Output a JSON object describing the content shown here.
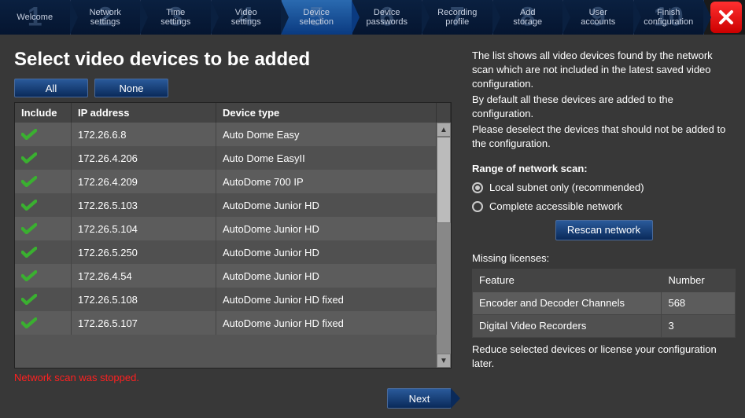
{
  "steps": [
    {
      "num": "1",
      "label": "Welcome"
    },
    {
      "num": "2",
      "label": "Network\nsettings"
    },
    {
      "num": "3",
      "label": "Time\nsettings"
    },
    {
      "num": "4",
      "label": "Video\nsettings"
    },
    {
      "num": "5",
      "label": "Device\nselection"
    },
    {
      "num": "6",
      "label": "Device\npasswords"
    },
    {
      "num": "7",
      "label": "Recording\nprofile"
    },
    {
      "num": "8",
      "label": "Add\nstorage"
    },
    {
      "num": "9",
      "label": "User\naccounts"
    },
    {
      "num": "10",
      "label": "Finish\nconfiguration"
    }
  ],
  "active_step": 4,
  "title": "Select video devices to be added",
  "buttons": {
    "all": "All",
    "none": "None",
    "next": "Next",
    "rescan": "Rescan network"
  },
  "table": {
    "headers": {
      "include": "Include",
      "ip": "IP address",
      "type": "Device type"
    },
    "rows": [
      {
        "ip": "172.26.6.8",
        "type": "Auto Dome Easy"
      },
      {
        "ip": "172.26.4.206",
        "type": "Auto Dome EasyII"
      },
      {
        "ip": "172.26.4.209",
        "type": "AutoDome 700 IP"
      },
      {
        "ip": "172.26.5.103",
        "type": "AutoDome Junior HD"
      },
      {
        "ip": "172.26.5.104",
        "type": "AutoDome Junior HD"
      },
      {
        "ip": "172.26.5.250",
        "type": "AutoDome Junior HD"
      },
      {
        "ip": "172.26.4.54",
        "type": "AutoDome Junior HD"
      },
      {
        "ip": "172.26.5.108",
        "type": "AutoDome Junior HD fixed"
      },
      {
        "ip": "172.26.5.107",
        "type": "AutoDome Junior HD fixed"
      }
    ]
  },
  "status": "Network scan was stopped.",
  "help": {
    "p1": "The list shows all video devices found by the network scan which are not included in the latest saved video configuration.",
    "p2": "By default all these devices are added to the configuration.",
    "p3": "Please deselect the devices that should not be added to the configuration."
  },
  "range": {
    "title": "Range of network scan:",
    "opt1": "Local subnet only (recommended)",
    "opt2": "Complete accessible network",
    "selected": 0
  },
  "licenses": {
    "title": "Missing licenses:",
    "headers": {
      "feature": "Feature",
      "number": "Number"
    },
    "rows": [
      {
        "feature": "Encoder and Decoder Channels",
        "number": "568"
      },
      {
        "feature": "Digital Video Recorders",
        "number": "3"
      }
    ],
    "note": "Reduce selected devices or license your configuration later."
  }
}
